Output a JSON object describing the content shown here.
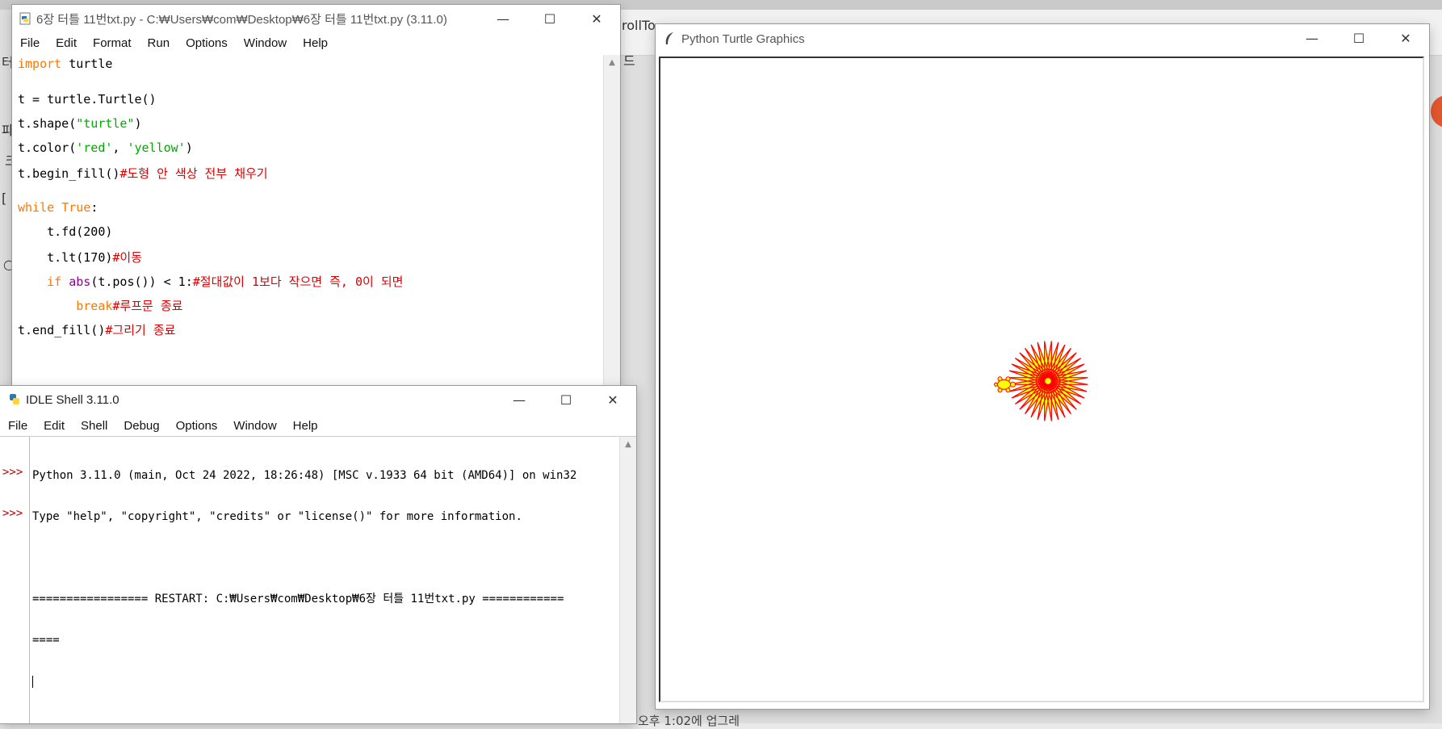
{
  "background": {
    "tab_fragment": "rollTo",
    "left_fragments": [
      "터",
      "파",
      "크",
      "[",
      "○"
    ],
    "right_fragment": "드",
    "footer_text": "오후 1:02에 업그레"
  },
  "editor": {
    "title": "6장 터틀 11번txt.py - C:₩Users₩com₩Desktop₩6장 터틀 11번txt.py (3.11.0)",
    "menu": [
      "File",
      "Edit",
      "Format",
      "Run",
      "Options",
      "Window",
      "Help"
    ],
    "code": [
      {
        "segments": [
          {
            "t": "import",
            "c": "kw"
          },
          {
            "t": " turtle",
            "c": ""
          }
        ]
      },
      {
        "segments": [
          {
            "t": "t = turtle.Turtle()",
            "c": ""
          }
        ]
      },
      {
        "segments": [
          {
            "t": "t.shape(",
            "c": ""
          },
          {
            "t": "\"turtle\"",
            "c": "st"
          },
          {
            "t": ")",
            "c": ""
          }
        ]
      },
      {
        "segments": [
          {
            "t": "t.color(",
            "c": ""
          },
          {
            "t": "'red'",
            "c": "st"
          },
          {
            "t": ", ",
            "c": ""
          },
          {
            "t": "'yellow'",
            "c": "st"
          },
          {
            "t": ")",
            "c": ""
          }
        ]
      },
      {
        "segments": [
          {
            "t": "t.begin_fill()",
            "c": ""
          },
          {
            "t": "#도형 안 색상 전부 채우기",
            "c": "cm"
          }
        ]
      },
      {
        "segments": [
          {
            "t": "while",
            "c": "kw"
          },
          {
            "t": " ",
            "c": ""
          },
          {
            "t": "True",
            "c": "kw"
          },
          {
            "t": ":",
            "c": ""
          }
        ]
      },
      {
        "segments": [
          {
            "t": "    t.fd(200)",
            "c": ""
          }
        ]
      },
      {
        "segments": [
          {
            "t": "    t.lt(170)",
            "c": ""
          },
          {
            "t": "#이동",
            "c": "cm"
          }
        ]
      },
      {
        "segments": [
          {
            "t": "    ",
            "c": ""
          },
          {
            "t": "if",
            "c": "kw"
          },
          {
            "t": " ",
            "c": ""
          },
          {
            "t": "abs",
            "c": "bi"
          },
          {
            "t": "(t.pos()) < 1:",
            "c": ""
          },
          {
            "t": "#절대값이 1보다 작으면 즉, 0이 되면",
            "c": "cm"
          }
        ]
      },
      {
        "segments": [
          {
            "t": "        ",
            "c": ""
          },
          {
            "t": "break",
            "c": "kw"
          },
          {
            "t": "#루프문 종료",
            "c": "cm"
          }
        ]
      },
      {
        "segments": [
          {
            "t": "t.end_fill()",
            "c": ""
          },
          {
            "t": "#그리기 종료",
            "c": "cm"
          }
        ]
      }
    ]
  },
  "shell": {
    "title": "IDLE Shell 3.11.0",
    "menu": [
      "File",
      "Edit",
      "Shell",
      "Debug",
      "Options",
      "Window",
      "Help"
    ],
    "prompt": ">>>",
    "lines": [
      "Python 3.11.0 (main, Oct 24 2022, 18:26:48) [MSC v.1933 64 bit (AMD64)] on win32",
      "Type \"help\", \"copyright\", \"credits\" or \"license()\" for more information.",
      "",
      "================= RESTART: C:₩Users₩com₩Desktop₩6장 터틀 11번txt.py ============",
      "===="
    ]
  },
  "turtle_window": {
    "title": "Python Turtle Graphics",
    "drawing": {
      "pen_color": "#ff0000",
      "fill_color": "#ffff00",
      "forward": 200,
      "turn_angle": 170
    }
  },
  "window_controls": {
    "minimize": "—",
    "maximize": "☐",
    "close": "✕"
  }
}
